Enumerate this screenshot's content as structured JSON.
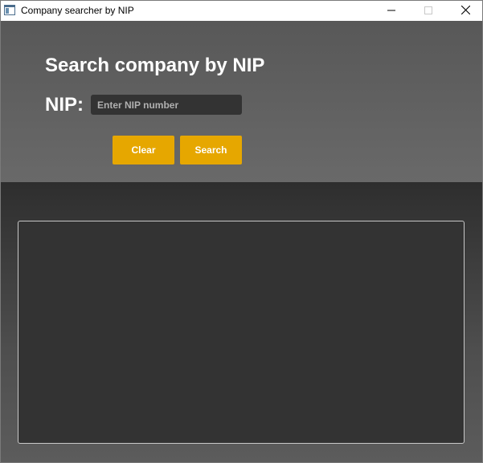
{
  "window": {
    "title": "Company searcher by NIP",
    "icons": {
      "app": "java-app-icon",
      "minimize": "minimize-icon",
      "maximize": "maximize-icon",
      "close": "close-icon"
    }
  },
  "header": {
    "title": "Search company by NIP",
    "nip_label": "NIP:",
    "nip_input": {
      "value": "",
      "placeholder": "Enter NIP number"
    },
    "buttons": {
      "clear_label": "Clear",
      "search_label": "Search"
    }
  },
  "results": {
    "value": ""
  },
  "colors": {
    "accent_button": "#e6a700",
    "header_bg_top": "#585858",
    "header_bg_bottom": "#696969",
    "input_bg": "#333333",
    "result_bg": "#333333"
  }
}
